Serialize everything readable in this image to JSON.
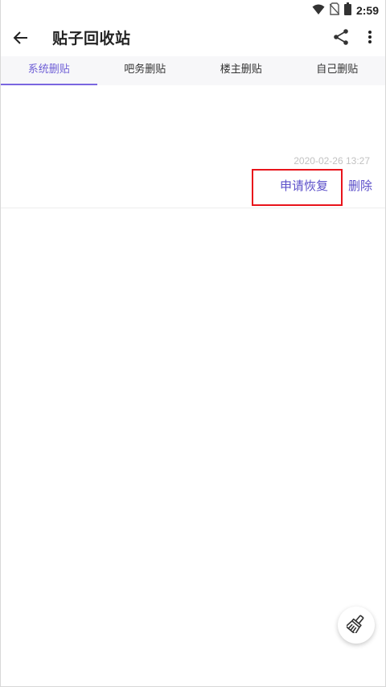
{
  "status_bar": {
    "time": "2:59",
    "icons": [
      "wifi-icon",
      "no-sim-icon",
      "battery-icon"
    ]
  },
  "app_bar": {
    "title": "贴子回收站",
    "back_icon": "arrow-left-icon",
    "share_icon": "share-icon",
    "more_icon": "more-vertical-icon"
  },
  "tabs": [
    {
      "label": "系统删贴",
      "active": true
    },
    {
      "label": "吧务删贴",
      "active": false
    },
    {
      "label": "楼主删贴",
      "active": false
    },
    {
      "label": "自己删贴",
      "active": false
    }
  ],
  "posts": [
    {
      "time": "2020-02-26 13:27",
      "restore_label": "申请恢复",
      "delete_label": "删除"
    }
  ],
  "fab": {
    "icon": "broom-icon"
  },
  "colors": {
    "accent": "#7a66e0",
    "action_text": "#5b4fc9",
    "muted_text": "#c2c2c2",
    "highlight": "#e8141b",
    "tab_bar_bg": "#f7f7f9"
  }
}
